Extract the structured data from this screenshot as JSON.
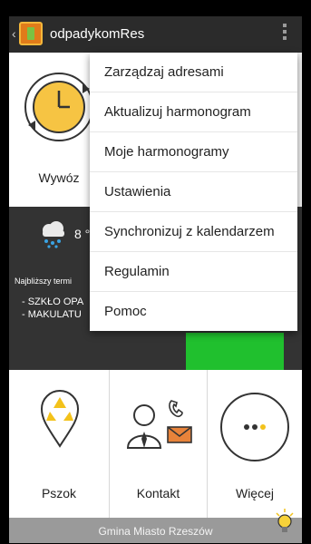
{
  "app": {
    "title": "odpadykomRes"
  },
  "tiles_top": {
    "wywoz_label": "Wywóz"
  },
  "weather": {
    "temp": "8 °"
  },
  "schedule": {
    "next_label": "Najbliższy termi",
    "items": [
      "- SZKŁO OPA",
      "- MAKULATU"
    ]
  },
  "tiles_bottom": {
    "pszok": "Pszok",
    "kontakt": "Kontakt",
    "wiecej": "Więcej"
  },
  "footer": {
    "text": "Gmina Miasto Rzeszów"
  },
  "menu": {
    "items": [
      "Zarządzaj adresami",
      "Aktualizuj harmonogram",
      "Moje harmonogramy",
      "Ustawienia",
      "Synchronizuj z kalendarzem",
      "Regulamin",
      "Pomoc"
    ]
  },
  "colors": {
    "appbar": "#2b2b2b",
    "accent_green": "#20c02e",
    "clock_yellow": "#f6c443",
    "recycle_yellow": "#f3c21b"
  }
}
